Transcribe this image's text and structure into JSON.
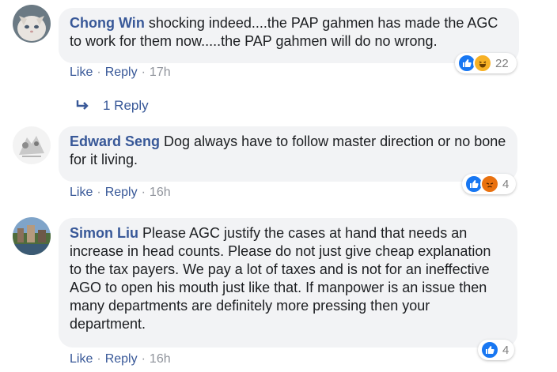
{
  "comments": [
    {
      "author": "Chong Win",
      "text": " shocking indeed....the PAP gahmen has made the AGC to work for them now.....the PAP gahmen will do no wrong.",
      "like_label": "Like",
      "reply_label": "Reply",
      "time": "17h",
      "reaction_count": "22",
      "reactions": [
        "like-icon",
        "haha-icon"
      ]
    },
    {
      "author": "Edward Seng",
      "text": " Dog always have to follow master direction or no bone for it living.",
      "like_label": "Like",
      "reply_label": "Reply",
      "time": "16h",
      "reaction_count": "4",
      "reactions": [
        "like-icon",
        "angry-icon"
      ]
    },
    {
      "author": "Simon Liu",
      "text": " Please AGC justify the cases at hand that needs an increase in head counts. Please do not just give cheap explanation to the tax payers. We pay a lot of taxes and is not for an ineffective AGO to open his mouth just like that. If manpower is an issue then many departments are definitely more pressing then your department.",
      "like_label": "Like",
      "reply_label": "Reply",
      "time": "16h",
      "reaction_count": "4",
      "reactions": [
        "like-icon"
      ]
    }
  ],
  "view_replies": "1 Reply",
  "separator": "·",
  "colors": {
    "link": "#385898",
    "bubble": "#f2f3f5",
    "meta": "#90949c",
    "like_blue": "#1877f2",
    "haha_yellow": "#f7b125",
    "angry_red": "#e9710f"
  }
}
